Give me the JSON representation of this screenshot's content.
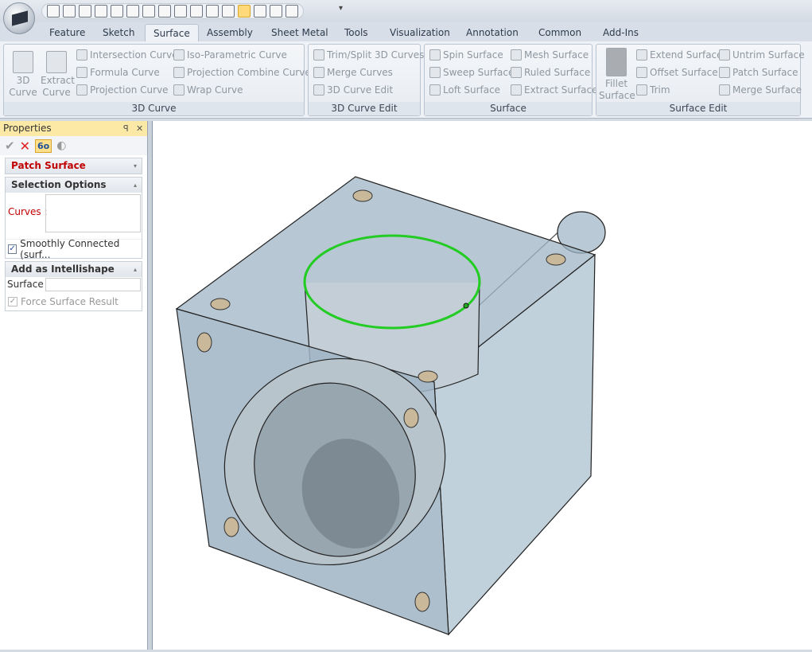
{
  "app": {
    "logo": "application-logo"
  },
  "quick_access": {
    "icons": [
      "new-icon",
      "open-red-icon",
      "save-as-icon",
      "export-icon",
      "folder-icon",
      "save-icon",
      "edit-icon",
      "tools-icon",
      "add-shape-icon",
      "undo-icon",
      "redo-icon",
      "render-icon",
      "tree-icon",
      "search-tree-icon",
      "list-icon",
      "copy-icon"
    ],
    "customize": "▾"
  },
  "tabs": [
    "Feature",
    "Sketch",
    "Surface",
    "Assembly",
    "Sheet Metal",
    "Tools",
    "Visualization",
    "Annotation",
    "Common",
    "Add-Ins"
  ],
  "active_tab": "Surface",
  "ribbon": {
    "curve3d": {
      "label": "3D Curve",
      "big": [
        {
          "l1": "3D",
          "l2": "Curve"
        },
        {
          "l1": "Extract",
          "l2": "Curve"
        }
      ],
      "items": [
        "Intersection Curve",
        "Formula Curve",
        "Projection Curve",
        "Iso-Parametric Curve",
        "Projection Combine Curve",
        "Wrap Curve"
      ]
    },
    "curveEdit": {
      "label": "3D Curve Edit",
      "items": [
        "Trim/Split 3D Curves",
        "Merge Curves",
        "3D Curve Edit"
      ]
    },
    "surface": {
      "label": "Surface",
      "items": [
        "Spin Surface",
        "Sweep Surface",
        "Loft Surface",
        "Mesh Surface",
        "Ruled Surface",
        "Extract Surface"
      ]
    },
    "surfaceEdit": {
      "label": "Surface Edit",
      "big": {
        "l1": "Fillet",
        "l2": "Surface"
      },
      "items": [
        "Extend Surface",
        "Offset Surface",
        "Trim",
        "Untrim Surface",
        "Patch Surface",
        "Merge Surface"
      ]
    }
  },
  "properties": {
    "title": "Properties",
    "pin": "ꟼ",
    "close": "✕",
    "tools": {
      "ok": "✔",
      "cancel": "✕",
      "preview": "6o",
      "other": "◐"
    },
    "command": "Patch Surface",
    "selection": {
      "title": "Selection Options",
      "curves_label": "Curves :",
      "smooth_label": "Smoothly Connected (surf...",
      "smooth_checked": true
    },
    "intellishape": {
      "title": "Add as Intellishape",
      "surface_label": "Surface",
      "surface_value": "",
      "force_label": "Force Surface Result",
      "force_checked": true
    },
    "collapse": "▴",
    "expand": "▾"
  },
  "colors": {
    "selected_edge": "#22cc22",
    "body": "#9fb4c4",
    "command": "#c00000"
  }
}
